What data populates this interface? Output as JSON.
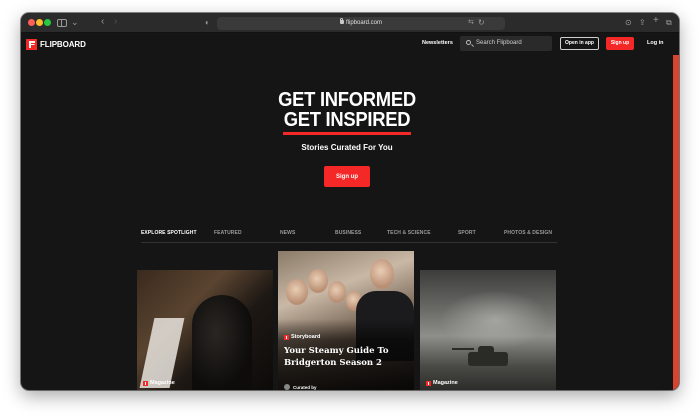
{
  "browser": {
    "address": "flipboard.com"
  },
  "nav": {
    "logo_text": "FLIPBOARD",
    "newsletters": "Newsletters",
    "search_placeholder": "Search Flipboard",
    "open_in_app": "Open in app",
    "sign_up": "Sign up",
    "log_in": "Log in"
  },
  "hero": {
    "line1": "GET INFORMED",
    "line2": "GET INSPIRED",
    "subtitle": "Stories Curated For You",
    "cta": "Sign up"
  },
  "tabs": [
    {
      "label": "EXPLORE SPOTLIGHT",
      "active": true
    },
    {
      "label": "FEATURED",
      "active": false
    },
    {
      "label": "NEWS",
      "active": false
    },
    {
      "label": "BUSINESS",
      "active": false
    },
    {
      "label": "TECH & SCIENCE",
      "active": false
    },
    {
      "label": "SPORT",
      "active": false
    },
    {
      "label": "PHOTOS & DESIGN",
      "active": false
    }
  ],
  "cards": {
    "left": {
      "badge": "Magazine"
    },
    "center": {
      "badge": "Storyboard",
      "title": "Your Steamy Guide To Bridgerton Season 2",
      "curated_by": "Curated by"
    },
    "right": {
      "badge": "Magazine"
    }
  },
  "colors": {
    "brand_red": "#f52828",
    "background": "#151515"
  }
}
